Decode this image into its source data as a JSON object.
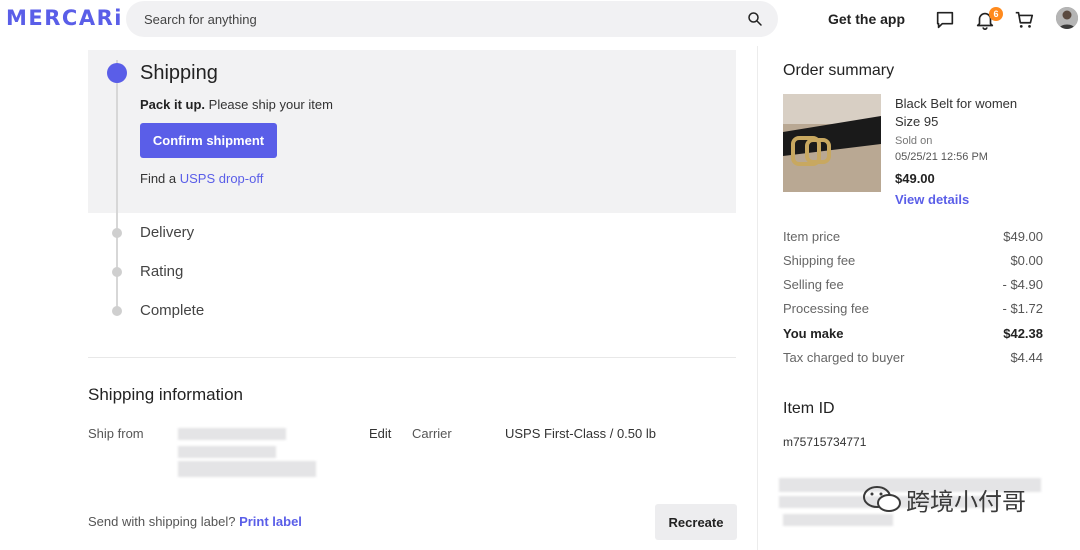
{
  "header": {
    "logo": "MERCARi",
    "search_placeholder": "Search for anything",
    "get_app": "Get the app",
    "notification_count": "6"
  },
  "progress": {
    "active_step": "Shipping",
    "pack_bold": "Pack it up.",
    "pack_text": " Please ship your item",
    "confirm_button": "Confirm shipment",
    "find_prefix": "Find a ",
    "find_link": "USPS drop-off",
    "steps": [
      "Delivery",
      "Rating",
      "Complete"
    ]
  },
  "shipping_info": {
    "title": "Shipping information",
    "ship_from_label": "Ship from",
    "edit": "Edit",
    "carrier_label": "Carrier",
    "carrier_value": "USPS First-Class / 0.50 lb",
    "label_prompt": "Send with shipping label? ",
    "print_label": "Print label",
    "recreate": "Recreate"
  },
  "order_summary": {
    "title": "Order summary",
    "product_name": "Black Belt for women",
    "product_size": "Size 95",
    "sold_on_label": "Sold on",
    "sold_on_date": "05/25/21 12:56 PM",
    "price": "$49.00",
    "view_details": "View details",
    "fees": [
      {
        "label": "Item price",
        "value": "$49.00"
      },
      {
        "label": "Shipping fee",
        "value": "$0.00"
      },
      {
        "label": "Selling fee",
        "value": "- $4.90"
      },
      {
        "label": "Processing fee",
        "value": "- $1.72"
      },
      {
        "label": "You make",
        "value": "$42.38"
      },
      {
        "label": "Tax charged to buyer",
        "value": "$4.44"
      }
    ]
  },
  "item": {
    "title": "Item ID",
    "id": "m75715734771"
  },
  "watermark": "跨境小付哥",
  "colors": {
    "accent": "#5a5ee8",
    "badge": "#ff8a1d"
  }
}
